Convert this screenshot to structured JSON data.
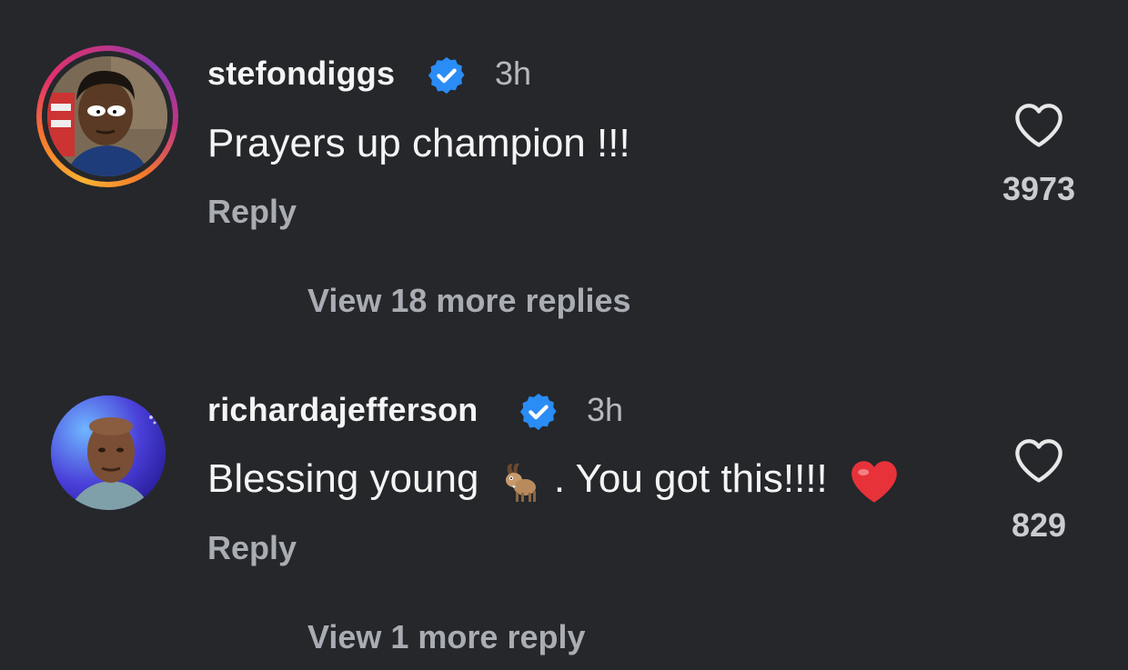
{
  "comments": [
    {
      "username": "stefondiggs",
      "verified_icon": "verified-badge-icon",
      "time": "3h",
      "text": "Prayers up champion !!!",
      "reply_label": "Reply",
      "likes": "3973",
      "view_more": "View 18 more replies",
      "avatar_ring": true
    },
    {
      "username": "richardajefferson",
      "verified_icon": "verified-badge-icon",
      "time": "3h",
      "text_before": "Blessing young",
      "text_emoji_1": "goat-emoji",
      "text_after": ". You got this!!!!",
      "text_emoji_2": "red-heart-emoji",
      "reply_label": "Reply",
      "likes": "829",
      "view_more": "View 1 more reply",
      "avatar_ring": false
    }
  ],
  "colors": {
    "background": "#25272b",
    "verified": "#2a8cf5",
    "secondary_text": "#a9adb3"
  }
}
